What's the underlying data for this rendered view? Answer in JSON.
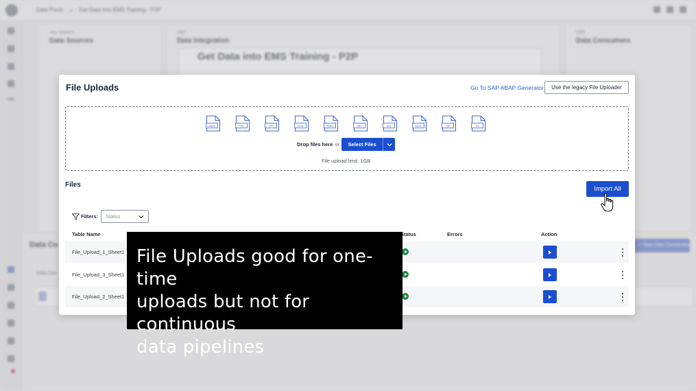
{
  "background": {
    "breadcrumb": [
      "Data Pools",
      "Get Data into EMS Training - P2P"
    ],
    "panels": [
      {
        "small": "Your Systems",
        "big": "Data Sources"
      },
      {
        "small": "EMS",
        "big": "Data Integration"
      },
      {
        "small": "EMS",
        "big": "Data Consumers"
      }
    ],
    "pool_title": "Get Data into EMS Training - P2P",
    "bottom_title": "Data Co",
    "bottom_subtitle": "Data Con",
    "new_connection_label": "+ New Data Connection"
  },
  "modal": {
    "title": "File Uploads",
    "abap_link": "Go To SAP ABAP Generator",
    "legacy_button": "Use the legacy File Uploader",
    "file_types": [
      "ABAP",
      "CSV",
      "TXT",
      "JSON",
      "PARQ",
      "AES",
      "XLS",
      "XLSX",
      "ZIP",
      "TIF"
    ],
    "drop_text": "Drop files here",
    "or_text": "or",
    "select_files_label": "Select Files",
    "upload_limit": "File upload limit: 1GB",
    "files_heading": "Files",
    "import_all_label": "Import All",
    "filters_label": "Filters:",
    "status_placeholder": "Status",
    "columns": {
      "table_name": "Table Name",
      "status": "Status",
      "errors": "Errors",
      "action": "Action"
    },
    "rows": [
      {
        "name": "File_Upload_1_Sheet1"
      },
      {
        "name": "File_Upload_3_Sheet1"
      },
      {
        "name": "File_Upload_2_Sheet1"
      }
    ]
  },
  "caption": {
    "lines": [
      "File Uploads good for one-time",
      "uploads but not for continuous",
      "data pipelines"
    ]
  },
  "colors": {
    "primary": "#1b4fd0",
    "status_ok": "#1d8745",
    "caption_bg": "#000000"
  }
}
